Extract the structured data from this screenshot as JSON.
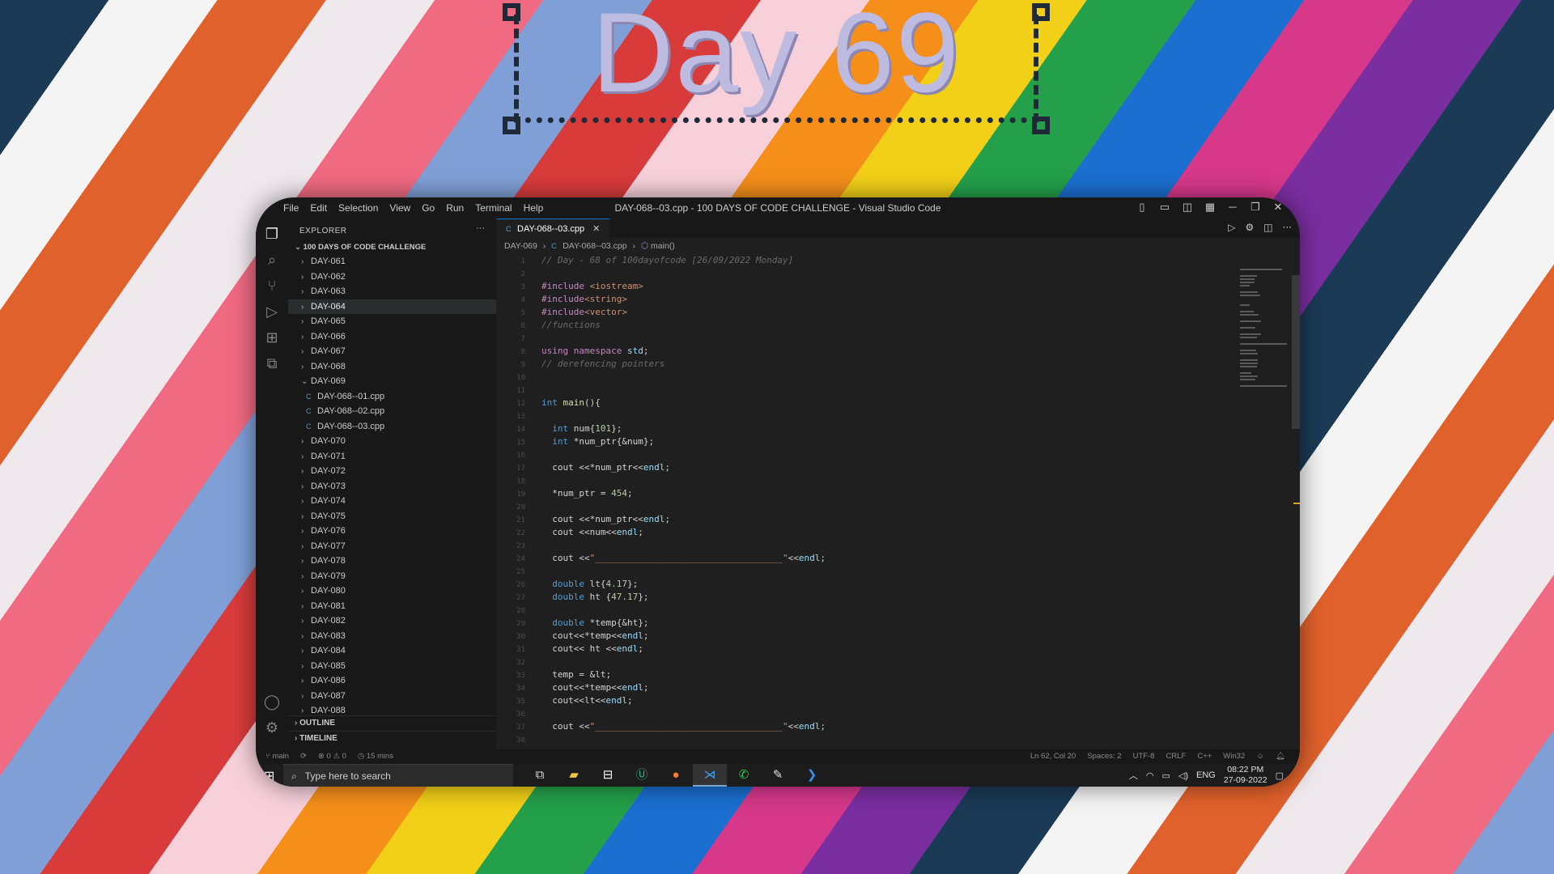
{
  "banner": {
    "title": "Day 69"
  },
  "window": {
    "menu": [
      "File",
      "Edit",
      "Selection",
      "View",
      "Go",
      "Run",
      "Terminal",
      "Help"
    ],
    "title": "DAY-068--03.cpp - 100 DAYS OF CODE CHALLENGE - Visual Studio Code",
    "controls": {
      "minimize": "─",
      "restore": "❐",
      "close": "✕"
    }
  },
  "activity_bar": [
    "files-icon",
    "search-icon",
    "source-control-icon",
    "run-debug-icon",
    "extensions-icon",
    "python-icon",
    "account-icon",
    "settings-gear-icon"
  ],
  "sidebar": {
    "header": "EXPLORER",
    "more": "···",
    "project": "100 DAYS OF CODE CHALLENGE",
    "folders_before": [
      "DAY-061",
      "DAY-062",
      "DAY-063",
      "DAY-064",
      "DAY-065",
      "DAY-066",
      "DAY-067",
      "DAY-068"
    ],
    "open_folder": "DAY-069",
    "files": [
      "DAY-068--01.cpp",
      "DAY-068--02.cpp",
      "DAY-068--03.cpp"
    ],
    "folders_after": [
      "DAY-070",
      "DAY-071",
      "DAY-072",
      "DAY-073",
      "DAY-074",
      "DAY-075",
      "DAY-076",
      "DAY-077",
      "DAY-078",
      "DAY-079",
      "DAY-080",
      "DAY-081",
      "DAY-082",
      "DAY-083",
      "DAY-084",
      "DAY-085",
      "DAY-086",
      "DAY-087",
      "DAY-088"
    ],
    "outline": "OUTLINE",
    "timeline": "TIMELINE"
  },
  "editor": {
    "tab": "DAY-068--03.cpp",
    "breadcrumb": [
      "DAY-069",
      "DAY-068--03.cpp",
      "main()"
    ],
    "lines": [
      {
        "n": "1",
        "t": "// Day - 68 of 100dayofcode [26/09/2022 Monday]"
      },
      {
        "n": "2",
        "t": ""
      },
      {
        "n": "3",
        "t": "#include <iostream>"
      },
      {
        "n": "4",
        "t": "#include<string>"
      },
      {
        "n": "5",
        "t": "#include<vector>"
      },
      {
        "n": "6",
        "t": "//functions"
      },
      {
        "n": "7",
        "t": ""
      },
      {
        "n": "8",
        "t": "using namespace std;"
      },
      {
        "n": "9",
        "t": "// derefencing pointers"
      },
      {
        "n": "10",
        "t": ""
      },
      {
        "n": "11",
        "t": ""
      },
      {
        "n": "12",
        "t": "int main(){"
      },
      {
        "n": "13",
        "t": ""
      },
      {
        "n": "14",
        "t": "  int num{101};"
      },
      {
        "n": "15",
        "t": "  int *num_ptr{&num};"
      },
      {
        "n": "16",
        "t": ""
      },
      {
        "n": "17",
        "t": "  cout <<*num_ptr<<endl;"
      },
      {
        "n": "18",
        "t": ""
      },
      {
        "n": "19",
        "t": "  *num_ptr = 454;"
      },
      {
        "n": "20",
        "t": ""
      },
      {
        "n": "21",
        "t": "  cout <<*num_ptr<<endl;"
      },
      {
        "n": "22",
        "t": "  cout <<num<<endl;"
      },
      {
        "n": "23",
        "t": ""
      },
      {
        "n": "24",
        "t": "  cout <<\"___________________________________\"<<endl;"
      },
      {
        "n": "25",
        "t": ""
      },
      {
        "n": "26",
        "t": "  double lt{4.17};"
      },
      {
        "n": "27",
        "t": "  double ht {47.17};"
      },
      {
        "n": "28",
        "t": ""
      },
      {
        "n": "29",
        "t": "  double *temp{&ht};"
      },
      {
        "n": "30",
        "t": "  cout<<*temp<<endl;"
      },
      {
        "n": "31",
        "t": "  cout<< ht <<endl;"
      },
      {
        "n": "32",
        "t": ""
      },
      {
        "n": "33",
        "t": "  temp = &lt;"
      },
      {
        "n": "34",
        "t": "  cout<<*temp<<endl;"
      },
      {
        "n": "35",
        "t": "  cout<<lt<<endl;"
      },
      {
        "n": "36",
        "t": ""
      },
      {
        "n": "37",
        "t": "  cout <<\"___________________________________\"<<endl;"
      },
      {
        "n": "38",
        "t": ""
      }
    ]
  },
  "statusbar": {
    "branch": "main",
    "problems": "⊗ 0 ⚠ 0",
    "time": "15 mins",
    "position": "Ln 62, Col 20",
    "spaces": "Spaces: 2",
    "encoding": "UTF-8",
    "eol": "CRLF",
    "language": "C++",
    "platform": "Win32"
  },
  "taskbar": {
    "search_placeholder": "Type here to search",
    "language": "ENG",
    "time": "08:22 PM",
    "date": "27-09-2022"
  },
  "colors": {
    "keyword": "#c586c0",
    "type": "#569cd6",
    "comment": "#6a6a6a",
    "number": "#b5cea8",
    "string": "#ce9178",
    "function": "#dcdcaa",
    "variable": "#9cdcfe",
    "tab_accent": "#0078d4"
  }
}
